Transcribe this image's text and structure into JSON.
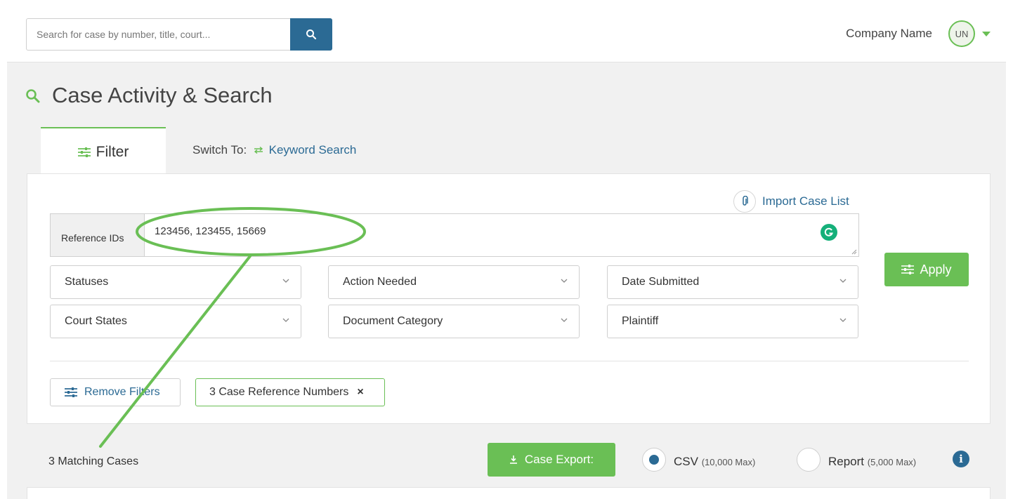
{
  "header": {
    "search_placeholder": "Search for case by number, title, court...",
    "company_name": "Company Name",
    "avatar_initials": "UN"
  },
  "page": {
    "title": "Case Activity & Search"
  },
  "tabs": {
    "filter_label": "Filter",
    "switch_to_prefix": "Switch To:",
    "switch_to_link": "Keyword Search"
  },
  "filters": {
    "import_label": "Import Case List",
    "reference_ids_label": "Reference IDs",
    "reference_ids_value": "123456, 123455, 15669",
    "dropdowns": [
      "Statuses",
      "Action Needed",
      "Date Submitted",
      "Court States",
      "Document Category",
      "Plaintiff"
    ],
    "apply_label": "Apply",
    "remove_label": "Remove Filters",
    "active_chip": "3 Case Reference Numbers",
    "chip_remove": "×"
  },
  "results": {
    "matching": "3 Matching Cases",
    "export_label": "Case Export:",
    "csv_label": "CSV",
    "csv_max": "(10,000 Max)",
    "csv_selected": true,
    "report_label": "Report",
    "report_max": "(5,000 Max)",
    "info": "i"
  },
  "colors": {
    "accent_green": "#6abf55",
    "brand_blue": "#2b6a94"
  }
}
